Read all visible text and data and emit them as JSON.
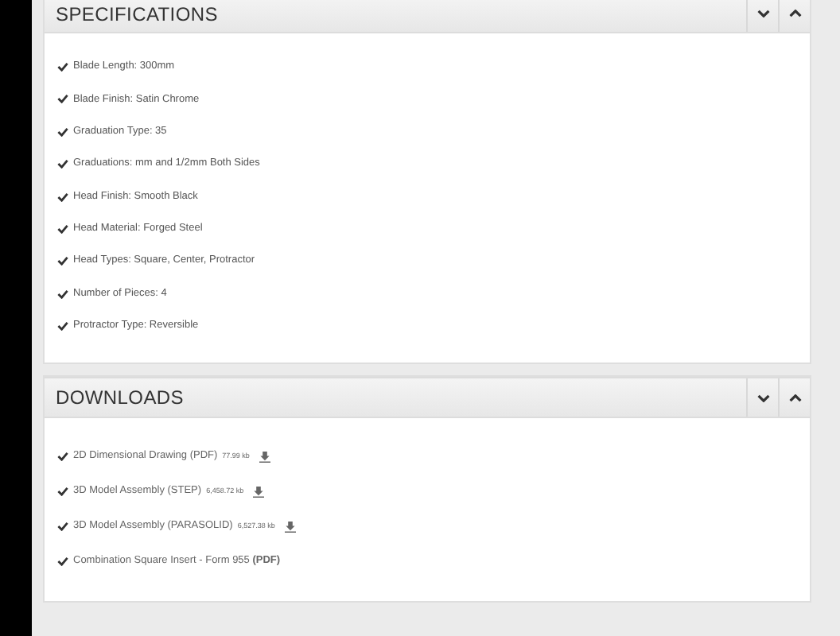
{
  "panels": [
    {
      "title": "SPECIFICATIONS",
      "kind": "specs",
      "items": [
        {
          "label": "Blade Length: 300mm"
        },
        {
          "label": "Blade Finish: Satin Chrome"
        },
        {
          "label": "Graduation Type: 35"
        },
        {
          "label": "Graduations: mm and 1/2mm Both Sides"
        },
        {
          "label": "Head Finish: Smooth Black"
        },
        {
          "label": "Head Material: Forged Steel"
        },
        {
          "label": "Head Types: Square, Center, Protractor"
        },
        {
          "label": "Number of Pieces: 4"
        },
        {
          "label": "Protractor Type: Reversible"
        }
      ]
    },
    {
      "title": "DOWNLOADS",
      "kind": "downloads",
      "items": [
        {
          "label": "2D Dimensional Drawing (PDF)",
          "size": "77.99 kb",
          "kind": "download"
        },
        {
          "label": "3D Model Assembly (STEP)",
          "size": "6,458.72 kb",
          "kind": "download"
        },
        {
          "label": "3D Model Assembly (PARASOLID)",
          "size": "6,527.38 kb",
          "kind": "download"
        },
        {
          "label": "Combination Square Insert - Form 955 **(PDF)**",
          "kind": "link"
        }
      ]
    }
  ]
}
